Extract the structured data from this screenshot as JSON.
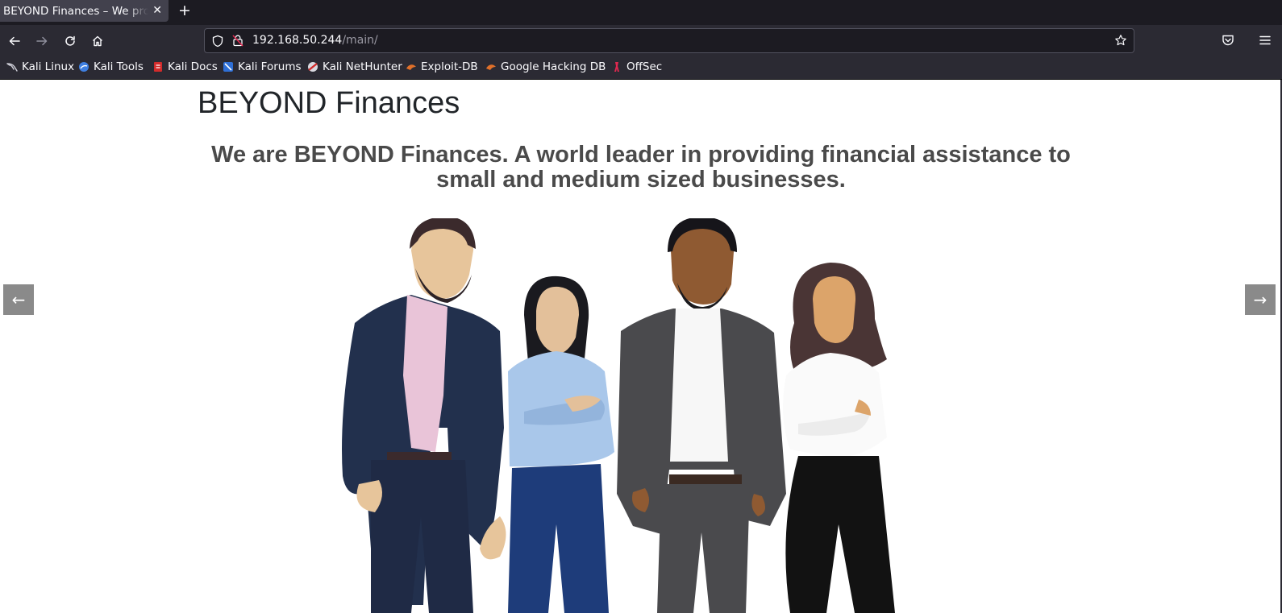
{
  "browser": {
    "tab": {
      "title": "BEYOND Finances – We provide financial assistance"
    },
    "new_tab_symbol": "+",
    "url": {
      "host": "192.168.50.244",
      "path": "/main/"
    },
    "bookmarks": [
      {
        "label": "Kali Linux",
        "icon": "kali-dragon-icon"
      },
      {
        "label": "Kali Tools",
        "icon": "kali-tools-icon"
      },
      {
        "label": "Kali Docs",
        "icon": "kali-docs-icon"
      },
      {
        "label": "Kali Forums",
        "icon": "kali-forums-icon"
      },
      {
        "label": "Kali NetHunter",
        "icon": "kali-nethunter-icon"
      },
      {
        "label": "Exploit-DB",
        "icon": "exploit-db-icon"
      },
      {
        "label": "Google Hacking DB",
        "icon": "ghdb-icon"
      },
      {
        "label": "OffSec",
        "icon": "offsec-icon"
      }
    ]
  },
  "page": {
    "brand": "BEYOND Finances",
    "tagline": "We are BEYOND Finances. A world leader in providing financial assistance to small and medium sized businesses.",
    "carousel": {
      "prev_symbol": "←",
      "next_symbol": "→"
    },
    "hero_image": "team-of-four-business-people-illustration"
  },
  "colors": {
    "tabstrip": "#1c1b22",
    "toolbar": "#2b2a33",
    "page_bg": "#ffffff",
    "heading": "#212529",
    "tagline": "#4a4a4a",
    "carousel_button": "#8a8a8a"
  }
}
